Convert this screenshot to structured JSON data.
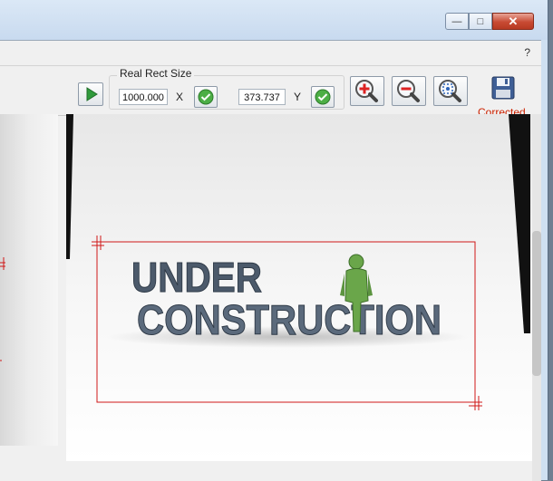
{
  "window": {
    "caption_buttons": {
      "minimize": "—",
      "maximize": "□",
      "close": "✕"
    },
    "help_label": "?"
  },
  "toolbar": {
    "play_icon": "play-icon",
    "group_label": "Real Rect Size",
    "x_value": "1000.000",
    "x_axis_label": "X",
    "y_value": "373.737",
    "y_axis_label": "Y",
    "confirm_icon": "check-icon",
    "zoom_in_icon": "zoom-in-icon",
    "zoom_out_icon": "zoom-out-icon",
    "zoom_fit_icon": "zoom-fit-icon",
    "save_icon": "save-icon",
    "status_text": "Corrected"
  },
  "image": {
    "line1": "UNDER",
    "line2": "CONSTRUCTION"
  },
  "colors": {
    "selection_rect": "#d01818",
    "status_text": "#cc2200",
    "text_3d": "#5b6a7c",
    "figure_green": "#6aa64a"
  }
}
